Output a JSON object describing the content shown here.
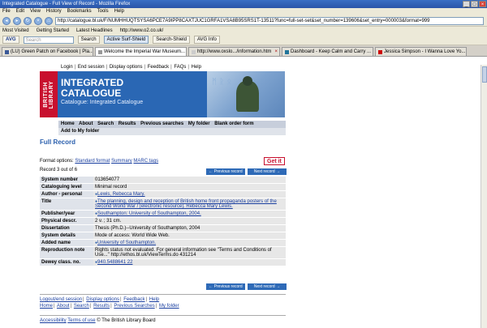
{
  "window": {
    "title": "Integrated Catalogue - Full View of Record - Mozilla Firefox"
  },
  "menu": [
    "File",
    "Edit",
    "View",
    "History",
    "Bookmarks",
    "Tools",
    "Help"
  ],
  "url": "http://catalogue.bl.uk/F/NUMHHUQTSYSA6PCE7A9IPP8CAXTJUC1GRFA1VSA8B95SRS1T-13511?func=full-set-set&set_number=139606&set_entry=000003&format=999",
  "bookmarks": [
    "Most Visited",
    "Getting Started",
    "Latest Headlines",
    "http://www.o2.co.uk/"
  ],
  "toolbar": {
    "avg": "AVG",
    "search_placeholder": "Search",
    "search_btn": "Search",
    "active_surf": "Active Surf-Shield",
    "search_shield": "Search-Shield",
    "avg_info": "AVG Info"
  },
  "tabs": [
    "(LU) Green Patch on Facebook | Pla...",
    "Welcome the Imperial War Museum...",
    "http://www.oxslo.../information.htm",
    "Dashboard - Keep Calm and Carry ...",
    "Jessica Simpson - I Wanna Love Yo..."
  ],
  "page": {
    "top_links": [
      "Login",
      "End session",
      "Display options",
      "Feedback",
      "FAQs",
      "Help"
    ],
    "banner": {
      "logo": "BRITISH LIBRARY",
      "title_line1": "INTEGRATED",
      "title_line2": "CATALOGUE",
      "subtitle": "Catalogue: Integrated Catalogue"
    },
    "main_nav": [
      "Home",
      "About",
      "Search",
      "Results",
      "Previous searches",
      "My folder",
      "Blank order form"
    ],
    "sub_nav": "Add to My folder",
    "section_title": "Full Record",
    "format_label": "Format options:",
    "formats": [
      "Standard format",
      "Summary",
      "MARC tags"
    ],
    "get_it": "Get it",
    "record_position": "Record 3 out of 6",
    "prev_btn": "← Previous record",
    "next_btn": "Next record →",
    "fields": [
      {
        "label": "System number",
        "value": "013654077"
      },
      {
        "label": "Cataloguing level",
        "value": "Minimal record"
      },
      {
        "label": "Author - personal",
        "value": "Lewis, Rebecca Mary."
      },
      {
        "label": "Title",
        "value": "The planning, design and reception of British home front propaganda posters of the Second World War / [electronic resource]. Rebecca Mary Lewis."
      },
      {
        "label": "Publisher/year",
        "value": "Southampton: University of Southampton, 2004."
      },
      {
        "label": "Physical descr.",
        "value": "2 v. ; 31 cm."
      },
      {
        "label": "Dissertation",
        "value": "Thesis (Ph.D.)--University of Southampton, 2004"
      },
      {
        "label": "System details",
        "value": "Mode of access: World Wide Web."
      },
      {
        "label": "Added name",
        "value": "University of Southampton."
      },
      {
        "label": "Reproduction note",
        "value": "Rights status not evaluated. For general information see \"Terms and Conditions of Use...\" http://ethos.bl.uk/ViewTerms.do 431214"
      },
      {
        "label": "Dewey class. no.",
        "value": "940.5488641 22"
      }
    ],
    "bottom_links_1": [
      "Logout/end session",
      "Display options",
      "Feedback",
      "Help"
    ],
    "bottom_links_2": [
      "Home",
      "About",
      "Search",
      "Results",
      "Previous Searches",
      "My folder"
    ],
    "footer_accessibility": "Accessibility",
    "footer_terms": "Terms of use",
    "footer_copy": "© The British Library Board"
  }
}
